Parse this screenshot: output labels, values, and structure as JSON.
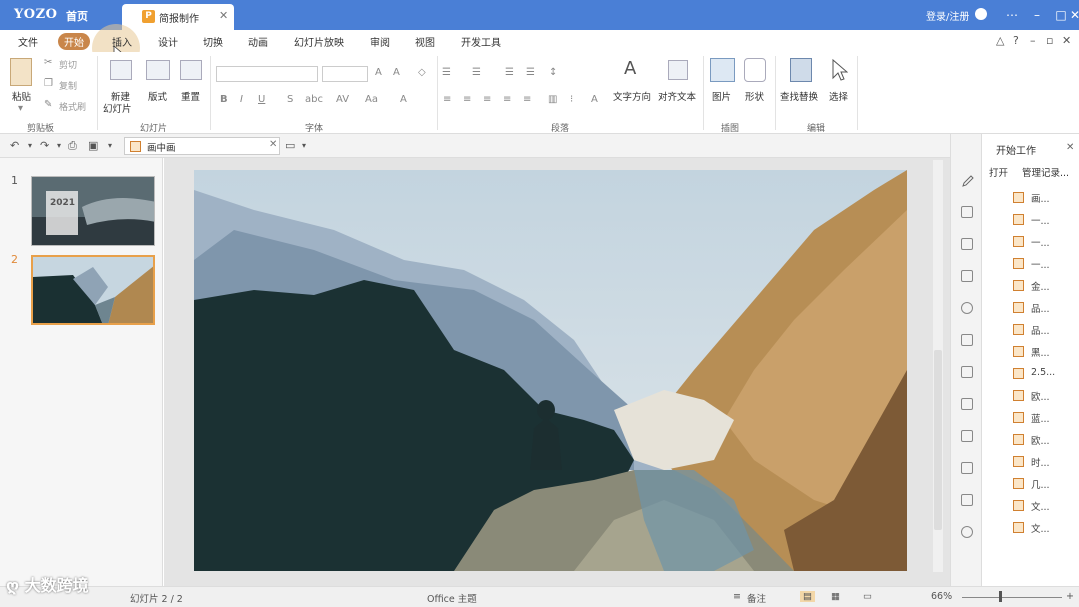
{
  "titlebar": {
    "logo": "YOZO",
    "home": "首页",
    "doc_tab": "简报制作",
    "doc_tab_icon": "P",
    "login": "登录/注册"
  },
  "menu": {
    "items": [
      "文件",
      "开始",
      "插入",
      "设计",
      "切换",
      "动画",
      "幻灯片放映",
      "审阅",
      "视图",
      "开发工具"
    ],
    "active_index": 1
  },
  "ribbon": {
    "clipboard": {
      "paste": "粘贴",
      "cut": "剪切",
      "copy": "复制",
      "format_painter": "格式刷",
      "group": "剪贴板"
    },
    "slides": {
      "new_slide": "新建",
      "new_slide2": "幻灯片",
      "layout": "版式",
      "reset": "重置",
      "group": "幻灯片"
    },
    "font": {
      "group": "字体"
    },
    "paragraph": {
      "group": "段落",
      "text_direction": "文字方向",
      "align_text": "对齐文本"
    },
    "illustrations": {
      "picture": "图片",
      "shape": "形状",
      "group": "插图"
    },
    "editing": {
      "find_replace": "查找替换",
      "select": "选择",
      "group": "编辑"
    }
  },
  "quickbar": {
    "file_tab": "画中画"
  },
  "slides_panel": {
    "numbers": [
      "1",
      "2"
    ],
    "thumb1_year": "2021",
    "selected": 2
  },
  "task_pane": {
    "title": "开始工作",
    "open": "打开",
    "manage": "管理记录...",
    "items": [
      "画...",
      "一...",
      "一...",
      "一...",
      "金...",
      "品...",
      "品...",
      "黑...",
      "2.5...",
      "欧...",
      "蓝...",
      "欧...",
      "时...",
      "几...",
      "文...",
      "文..."
    ]
  },
  "statusbar": {
    "slide_info": "幻灯片 2 / 2",
    "theme": "Office 主题",
    "notes": "备注",
    "zoom": "66%"
  },
  "watermark": "大数跨境",
  "colors": {
    "title_blue": "#4a7fd6",
    "active_tab": "#c9864a",
    "selected_thumb": "#e8a04a"
  }
}
